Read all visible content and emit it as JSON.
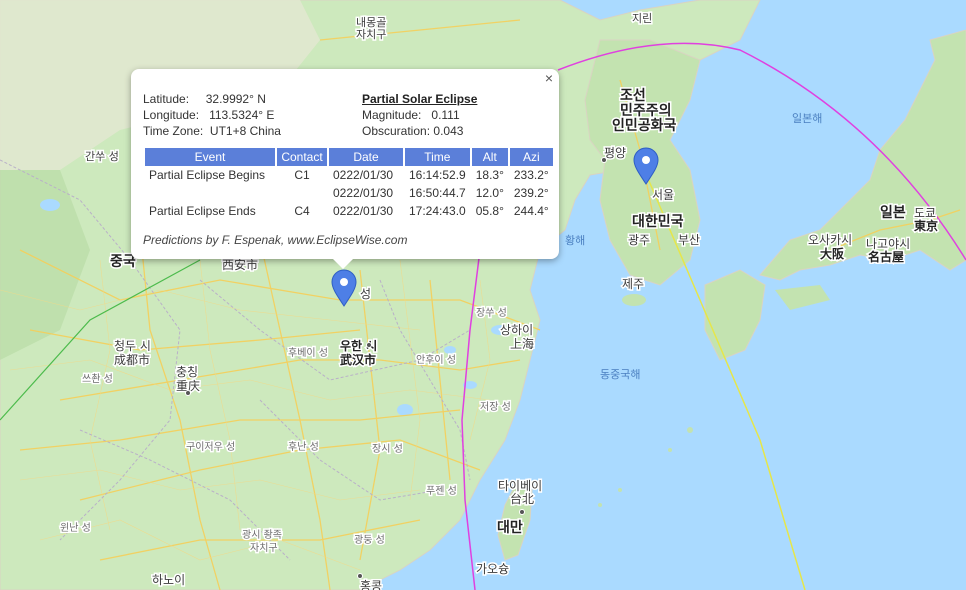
{
  "popup": {
    "latitude_label": "Latitude:",
    "latitude_value": "32.9992° N",
    "longitude_label": "Longitude:",
    "longitude_value": "113.5324° E",
    "timezone_label": "Time Zone:",
    "timezone_value": "UT1+8 China",
    "eclipse_title": "Partial Solar Eclipse",
    "magnitude_label": "Magnitude:",
    "magnitude_value": "0.111",
    "obscuration_label": "Obscuration:",
    "obscuration_value": "0.043",
    "close_glyph": "×",
    "headers": [
      "Event",
      "Contact",
      "Date",
      "Time",
      "Alt",
      "Azi"
    ],
    "rows": [
      [
        "Partial Eclipse Begins",
        "C1",
        "0222/01/30",
        "16:14:52.9",
        "18.3°",
        "233.2°"
      ],
      [
        "",
        "",
        "0222/01/30",
        "16:50:44.7",
        "12.0°",
        "239.2°"
      ],
      [
        "Partial Eclipse Ends",
        "C4",
        "0222/01/30",
        "17:24:43.0",
        "05.8°",
        "244.4°"
      ]
    ],
    "credit": "Predictions by F. Espenak, www.EclipseWise.com"
  },
  "map": {
    "colors": {
      "sea": "#aadaff",
      "land": "#c9e7b8",
      "path_magenta": "#e040e0",
      "path_yellow": "#e6e64a",
      "path_green": "#4cbb4c",
      "marker": "#4e7fe6"
    },
    "labels": {
      "naemonggo": "내몽골",
      "jachigu_n": "자치구",
      "jilin": "지린",
      "joseon1": "조선",
      "joseon2": "민주주의",
      "joseon3": "인민공화국",
      "pyongyang": "평양",
      "seoul": "서울",
      "korea": "대한민국",
      "gwangju": "광주",
      "busan": "부산",
      "jeju": "제주",
      "east_sea": "일본해",
      "yellow_sea": "황해",
      "east_china_sea": "동중국해",
      "japan": "일본",
      "tokyo_kr": "도쿄",
      "tokyo_jp": "東京",
      "osaka_kr": "오사카시",
      "osaka_jp": "大阪",
      "nagoya_kr": "나고야시",
      "nagoya_jp": "名古屋",
      "china": "중국",
      "xian": "西安市",
      "sheng_a": "성",
      "chengdu_kr": "청두 시",
      "chengdu_cn": "成都市",
      "chongqing_kr": "충칭",
      "chongqing_cn": "重庆",
      "wuhan_kr": "우한 시",
      "wuhan_cn": "武汉市",
      "hubei": "후베이 성",
      "anhui": "안후이 성",
      "jiangsu": "장쑤 성",
      "shanghai_kr": "상하이",
      "shanghai_cn": "上海",
      "zhejiang": "저장 성",
      "hunan": "후난 성",
      "jiangxi": "장시 성",
      "guizhou": "구이저우 성",
      "fujian": "푸젠 성",
      "guangdong": "광둥 성",
      "guangxi1": "광시 좡족",
      "guangxi2": "자치구",
      "yunnan": "윈난 성",
      "sichuan": "쓰촨 성",
      "taipei_kr": "타이베이",
      "taipei_cn": "台北",
      "taiwan": "대만",
      "kaohsiung": "가오슝",
      "hanoi": "하노이",
      "hongkong": "홍콩",
      "gansu": "간쑤 성"
    }
  }
}
